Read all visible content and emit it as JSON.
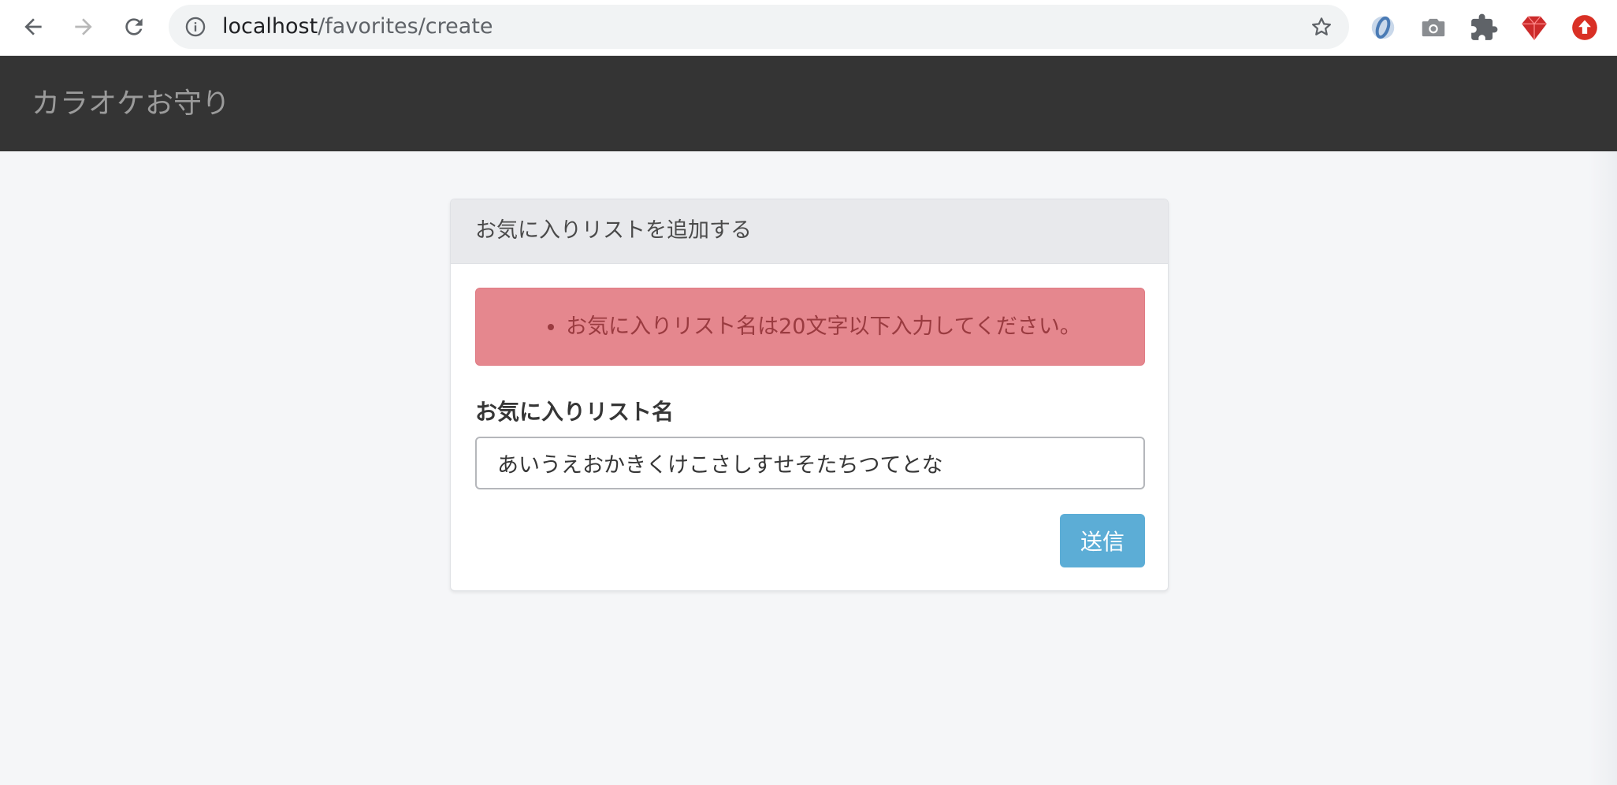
{
  "browser": {
    "url_host": "localhost",
    "url_path": "/favorites/create",
    "icons": {
      "back": "back-arrow-icon",
      "forward": "forward-arrow-icon",
      "reload": "reload-icon",
      "info": "info-icon",
      "bookmark": "star-icon",
      "extensions": [
        "blue-ring-extension-icon",
        "camera-extension-icon",
        "puzzle-extension-icon",
        "ruby-extension-icon",
        "red-upload-extension-icon"
      ]
    }
  },
  "navbar": {
    "brand": "カラオケお守り",
    "background": "#343434"
  },
  "card": {
    "title": "お気に入りリストを追加する",
    "errors": [
      "お気に入りリスト名は20文字以下入力してください。"
    ],
    "field_label": "お気に入りリスト名",
    "field_value": "あいうえおかきくけこさしすせそたちつてとな",
    "submit_label": "送信"
  },
  "colors": {
    "alert_background": "#e5878e",
    "alert_text": "#9a3b40",
    "submit_button": "#5cadd6"
  }
}
